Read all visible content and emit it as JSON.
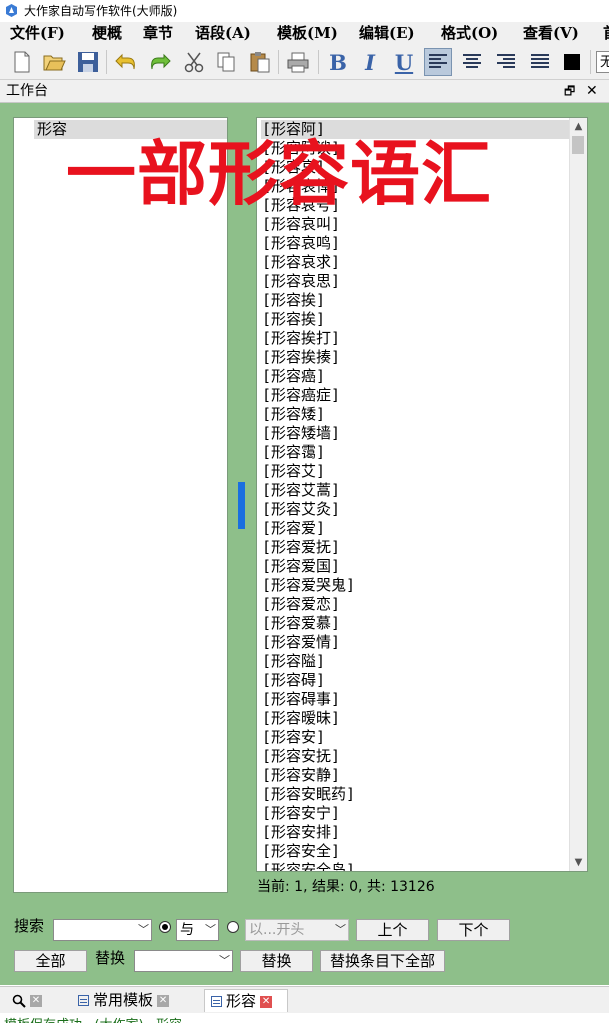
{
  "window": {
    "title": "大作家自动写作软件(大师版)"
  },
  "menu": [
    "文件(F)",
    "梗概",
    "章节",
    "语段(A)",
    "模板(M)",
    "编辑(E)",
    "格式(O)",
    "查看(V)",
    "首"
  ],
  "toolbar": {
    "icons": [
      "new-file-icon",
      "open-folder-icon",
      "save-icon",
      "undo-icon",
      "redo-icon",
      "cut-icon",
      "copy-icon",
      "paste-icon",
      "print-icon",
      "bold-icon",
      "italic-icon",
      "underline-icon",
      "align-left-icon",
      "align-center-icon",
      "align-right-icon",
      "justify-icon",
      "color-icon"
    ],
    "bold": "B",
    "italic": "I",
    "underline": "U",
    "right_combo": "无"
  },
  "panel": {
    "title": "工作台",
    "pin": "🗗",
    "close": "✕"
  },
  "left_list": {
    "selected": "形容"
  },
  "right_list": {
    "items": [
      "[形容阿]",
      "[形容阿谀]",
      "[形容哀]",
      "[形容哀悼]",
      "[形容哀号]",
      "[形容哀叫]",
      "[形容哀鸣]",
      "[形容哀求]",
      "[形容哀思]",
      "[形容挨]",
      "[形容挨]",
      "[形容挨打]",
      "[形容挨揍]",
      "[形容癌]",
      "[形容癌症]",
      "[形容矮]",
      "[形容矮墙]",
      "[形容霭]",
      "[形容艾]",
      "[形容艾蒿]",
      "[形容艾灸]",
      "[形容爱]",
      "[形容爱抚]",
      "[形容爱国]",
      "[形容爱哭鬼]",
      "[形容爱恋]",
      "[形容爱慕]",
      "[形容爱情]",
      "[形容隘]",
      "[形容碍]",
      "[形容碍事]",
      "[形容暧昧]",
      "[形容安]",
      "[形容安抚]",
      "[形容安静]",
      "[形容安眠药]",
      "[形容安宁]",
      "[形容安排]",
      "[形容安全]",
      "[形容安全岛]"
    ]
  },
  "status": "当前: 1, 结果: 0, 共: 13126",
  "overlay_text": "一部形容语汇",
  "search": {
    "label": "搜索",
    "value": "",
    "mode": "与",
    "starts_with": "以...开头",
    "prev": "上个",
    "next": "下个"
  },
  "replace": {
    "all": "全部",
    "label": "替换",
    "value": "",
    "button": "替换",
    "replace_all": "替换条目下全部"
  },
  "tabs": [
    {
      "label": "",
      "icon": "search-icon"
    },
    {
      "label": "常用模板"
    },
    {
      "label": "形容"
    }
  ],
  "bottom_hint": "模板保存成功...(大作家)...形容"
}
